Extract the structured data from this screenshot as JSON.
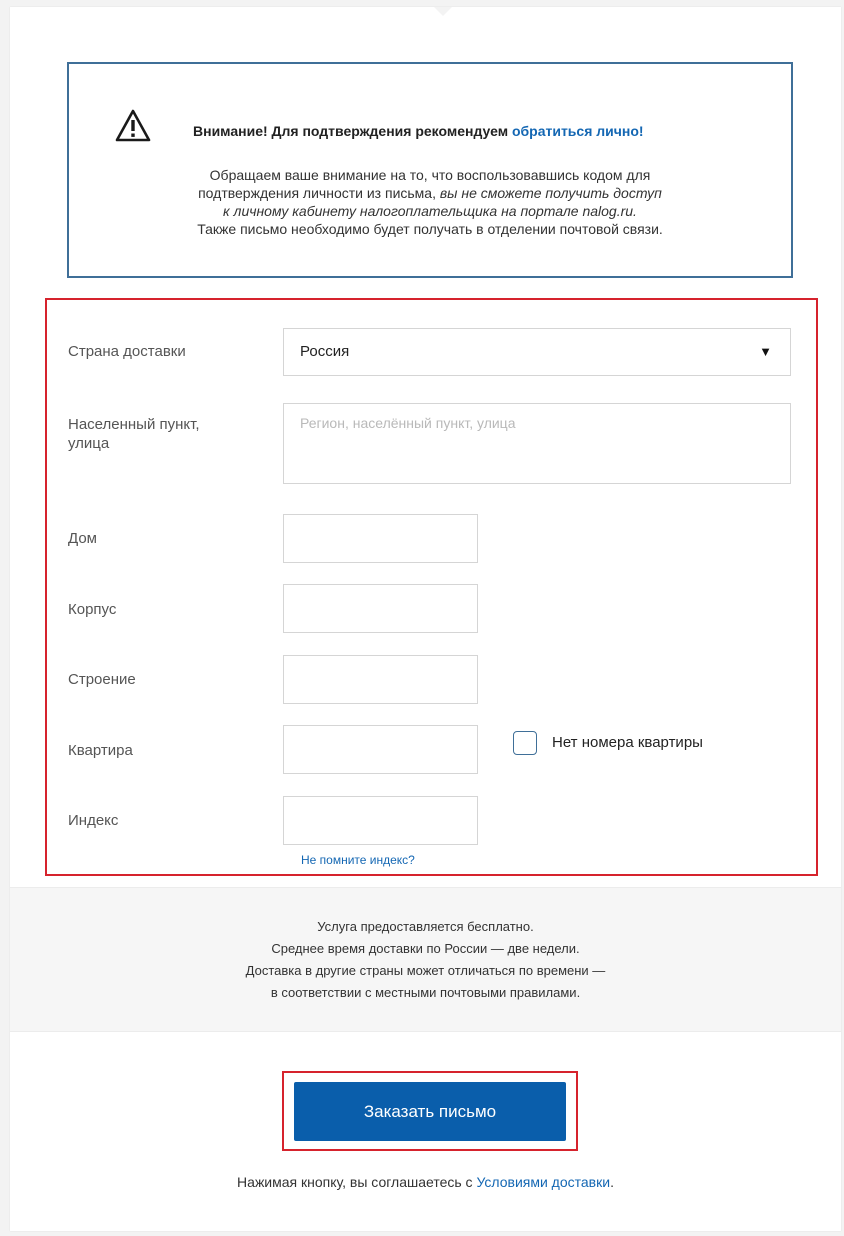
{
  "warning": {
    "icon": "warning-triangle-icon",
    "title_prefix": "Внимание! Для подтверждения рекомендуем ",
    "title_link": "обратиться лично!",
    "body_line1": "Обращаем ваше внимание на то, что воспользовавшись кодом для",
    "body_line2_normal": "подтверждения личности из письма, ",
    "body_line2_italic": "вы не сможете получить доступ",
    "body_line3_italic": "к личному кабинету налогоплательщика на портале nalog.ru.",
    "body_line4": "Также письмо необходимо будет получать в отделении почтовой связи."
  },
  "form": {
    "country_label": "Страна доставки",
    "country_value": "Россия",
    "address_label_line1": "Населенный пункт,",
    "address_label_line2": "улица",
    "address_placeholder": "Регион, населённый пункт, улица",
    "house_label": "Дом",
    "building_label": "Корпус",
    "structure_label": "Строение",
    "apartment_label": "Квартира",
    "no_apartment_label": "Нет номера квартиры",
    "no_apartment_checked": false,
    "index_label": "Индекс",
    "index_hint_link": "Не помните индекс?"
  },
  "info": {
    "line1": "Услуга предоставляется бесплатно.",
    "line2": "Среднее время доставки по России — две недели.",
    "line3": "Доставка в другие страны может отличаться по времени —",
    "line4": "в соответствии с местными  почтовыми правилами."
  },
  "submit": {
    "label": "Заказать письмо"
  },
  "agreement": {
    "prefix": "Нажимая кнопку, вы соглашаетесь с ",
    "link": "Условиями доставки",
    "suffix": "."
  },
  "colors": {
    "accent_blue": "#0a5eab",
    "link_blue": "#1467b3",
    "highlight_red": "#d6232d",
    "warning_border": "#3f6f98"
  }
}
